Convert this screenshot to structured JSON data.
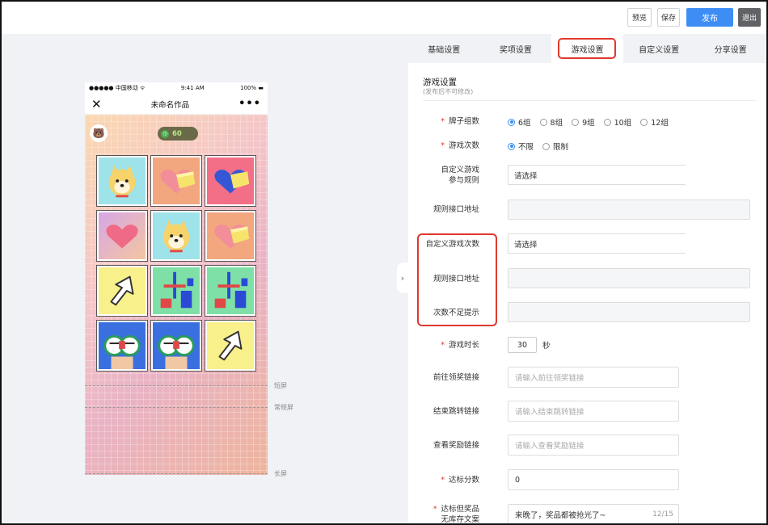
{
  "toolbar": {
    "preview": "预览",
    "save": "保存",
    "publish": "发布",
    "exit": "退出"
  },
  "phone": {
    "carrier": "●●●●● 中国移动 ᯤ",
    "time": "9:41 AM",
    "battery": "100%",
    "title": "未命名作品",
    "timer": "60",
    "cards": [
      "doge",
      "heart-gift",
      "heart-gift-blue",
      "heart-pink",
      "doge",
      "heart-gift",
      "cursor",
      "robot",
      "robot",
      "vr-kid",
      "vr-kid",
      "cursor"
    ]
  },
  "markers": {
    "short": "短屏",
    "normal": "常规屏",
    "long": "长屏"
  },
  "tabs": [
    "基础设置",
    "奖项设置",
    "游戏设置",
    "自定义设置",
    "分享设置"
  ],
  "active_tab": "游戏设置",
  "section": {
    "title": "游戏设置",
    "subtitle": "(发布后不可修改)"
  },
  "form": {
    "card_groups": {
      "label": "牌子组数",
      "options": [
        "6组",
        "8组",
        "9组",
        "10组",
        "12组"
      ],
      "selected": "6组"
    },
    "play_count": {
      "label": "游戏次数",
      "options": [
        "不限",
        "限制"
      ],
      "selected": "不限"
    },
    "custom_rule": {
      "label_line1": "自定义游戏",
      "label_line2": "参与规则",
      "value": "请选择"
    },
    "rule_api_1": {
      "label": "规则接口地址"
    },
    "custom_count": {
      "label": "自定义游戏次数",
      "value": "请选择"
    },
    "rule_api_2": {
      "label": "规则接口地址"
    },
    "insufficient_tip": {
      "label": "次数不足提示"
    },
    "duration": {
      "label": "游戏时长",
      "value": "30",
      "unit": "秒"
    },
    "prize_link": {
      "label": "前往领奖链接",
      "placeholder": "请输入前往领奖链接"
    },
    "end_link": {
      "label": "结束跳转链接",
      "placeholder": "请输入结束跳转链接"
    },
    "reward_link": {
      "label": "查看奖励链接",
      "placeholder": "请输入查看奖励链接"
    },
    "target_score": {
      "label": "达标分数",
      "value": "0"
    },
    "no_stock": {
      "label_line1": "达标但奖品",
      "label_line2": "无库存文案",
      "value": "来晚了，奖品都被抢光了~",
      "counter": "12/15"
    }
  }
}
